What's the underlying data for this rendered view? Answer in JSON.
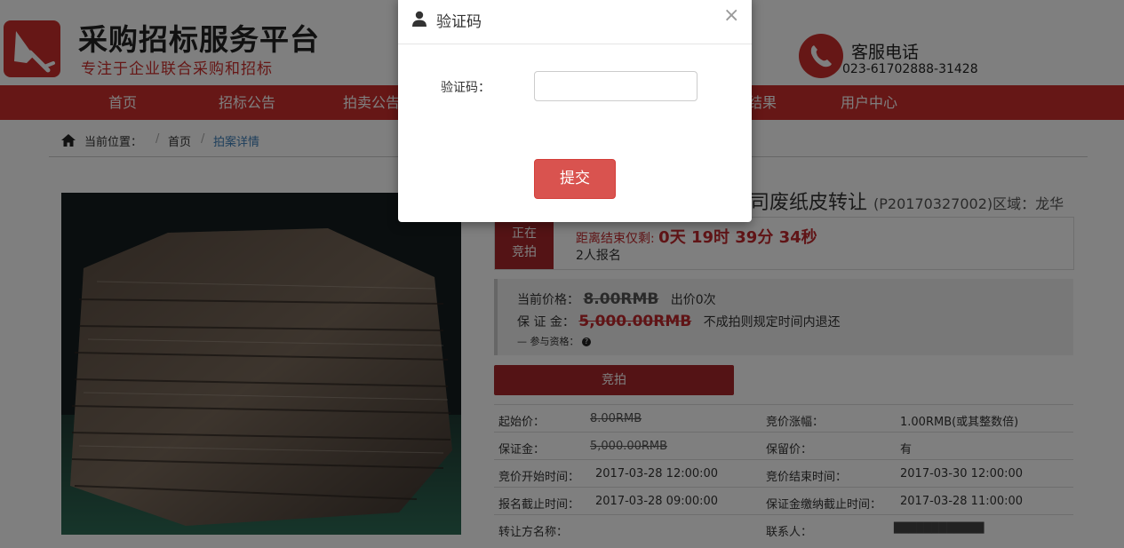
{
  "header": {
    "site_title": "采购招标服务平台",
    "site_subtitle": "专注于企业联合采购和招标",
    "phone_label": "客服电话",
    "phone_number": "023-61702888-31428"
  },
  "nav": {
    "items": [
      "首页",
      "招标公告",
      "拍卖公告",
      "结果",
      "用户中心"
    ]
  },
  "breadcrumb": {
    "prefix": "当前位置：",
    "sep": "/",
    "home": "首页",
    "current": "拍案详情"
  },
  "lot": {
    "title_tail": "司废纸皮转让",
    "code_region": "(P20170327002)区域：龙华",
    "status_tag": "正在竞拍",
    "countdown_label": "距离结束仅剩:",
    "countdown_value": "0天 19时 39分 34秒",
    "signups": "2人报名"
  },
  "price": {
    "current_label": "当前价格：",
    "current_value": "8.00RMB",
    "bid_count": "出价0次",
    "deposit_label": "保 证 金：",
    "deposit_value": "5,000.00RMB",
    "deposit_note": "不成拍则规定时间内退还",
    "qualification": "— 参与资格："
  },
  "bid_button": "竞拍",
  "info": {
    "rows": [
      {
        "l1": "起始价：",
        "v1": "8.00RMB",
        "l2": "竞价涨幅：",
        "v2": "1.00RMB(或其整数倍)"
      },
      {
        "l1": "保证金：",
        "v1": "5,000.00RMB",
        "l2": "保留价：",
        "v2": "有"
      },
      {
        "l1": "竞价开始时间：",
        "v1": "2017-03-28 12:00:00",
        "l2": "竞价结束时间：",
        "v2": "2017-03-30 12:00:00"
      },
      {
        "l1": "报名截止时间：",
        "v1": "2017-03-28 09:00:00",
        "l2": "保证金缴纳截止时间：",
        "v2": "2017-03-28 11:00:00"
      },
      {
        "l1": "转让方名称：",
        "v1": "",
        "l2": "联系人：",
        "v2": "████████████"
      }
    ]
  },
  "modal": {
    "title": "验证码",
    "close": "×",
    "field_label": "验证码：",
    "input_value": "",
    "submit": "提交"
  },
  "colors": {
    "brand_red": "#cd2f2c",
    "dark_red": "#a8262a",
    "submit_red": "#d9534f"
  }
}
